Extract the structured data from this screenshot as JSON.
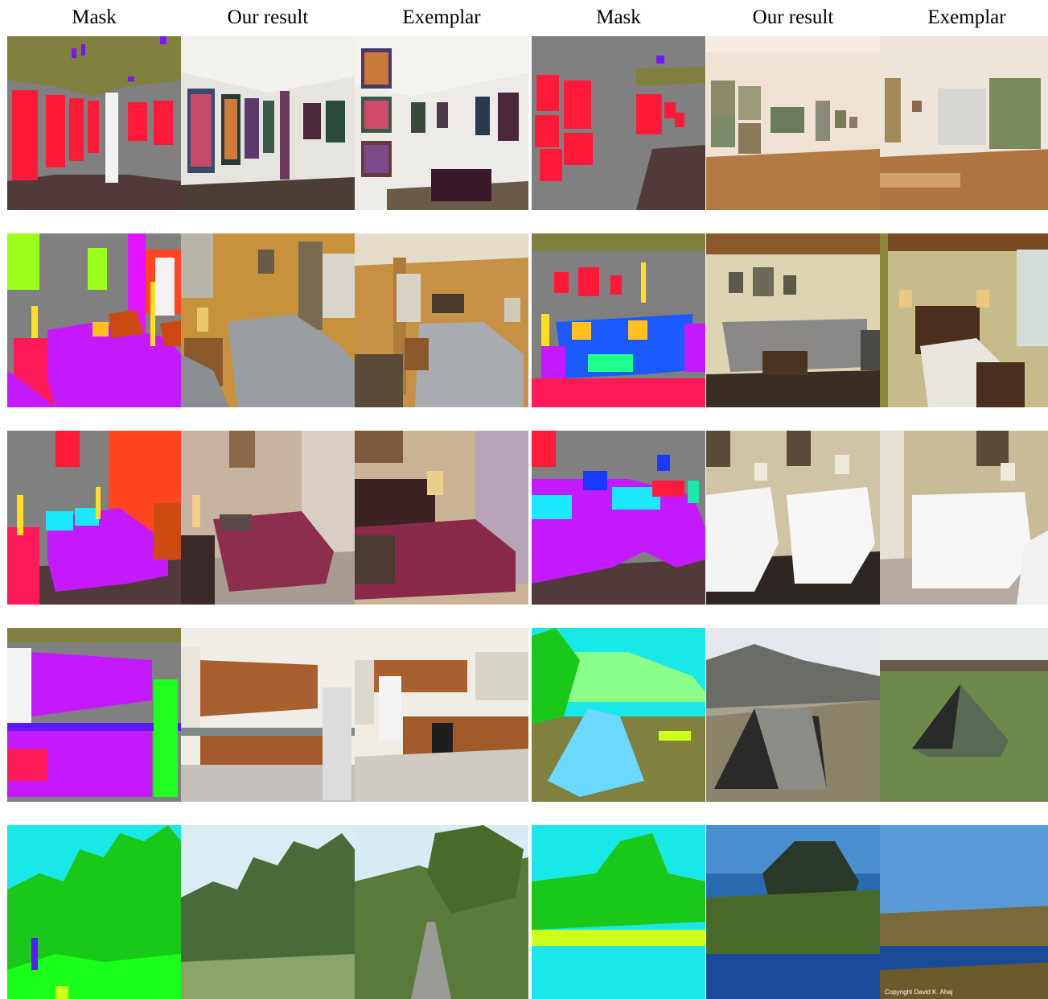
{
  "headers": [
    "Mask",
    "Our result",
    "Exemplar",
    "Mask",
    "Our result",
    "Exemplar"
  ],
  "copyright_text": "Copyright David K. Ahaj"
}
